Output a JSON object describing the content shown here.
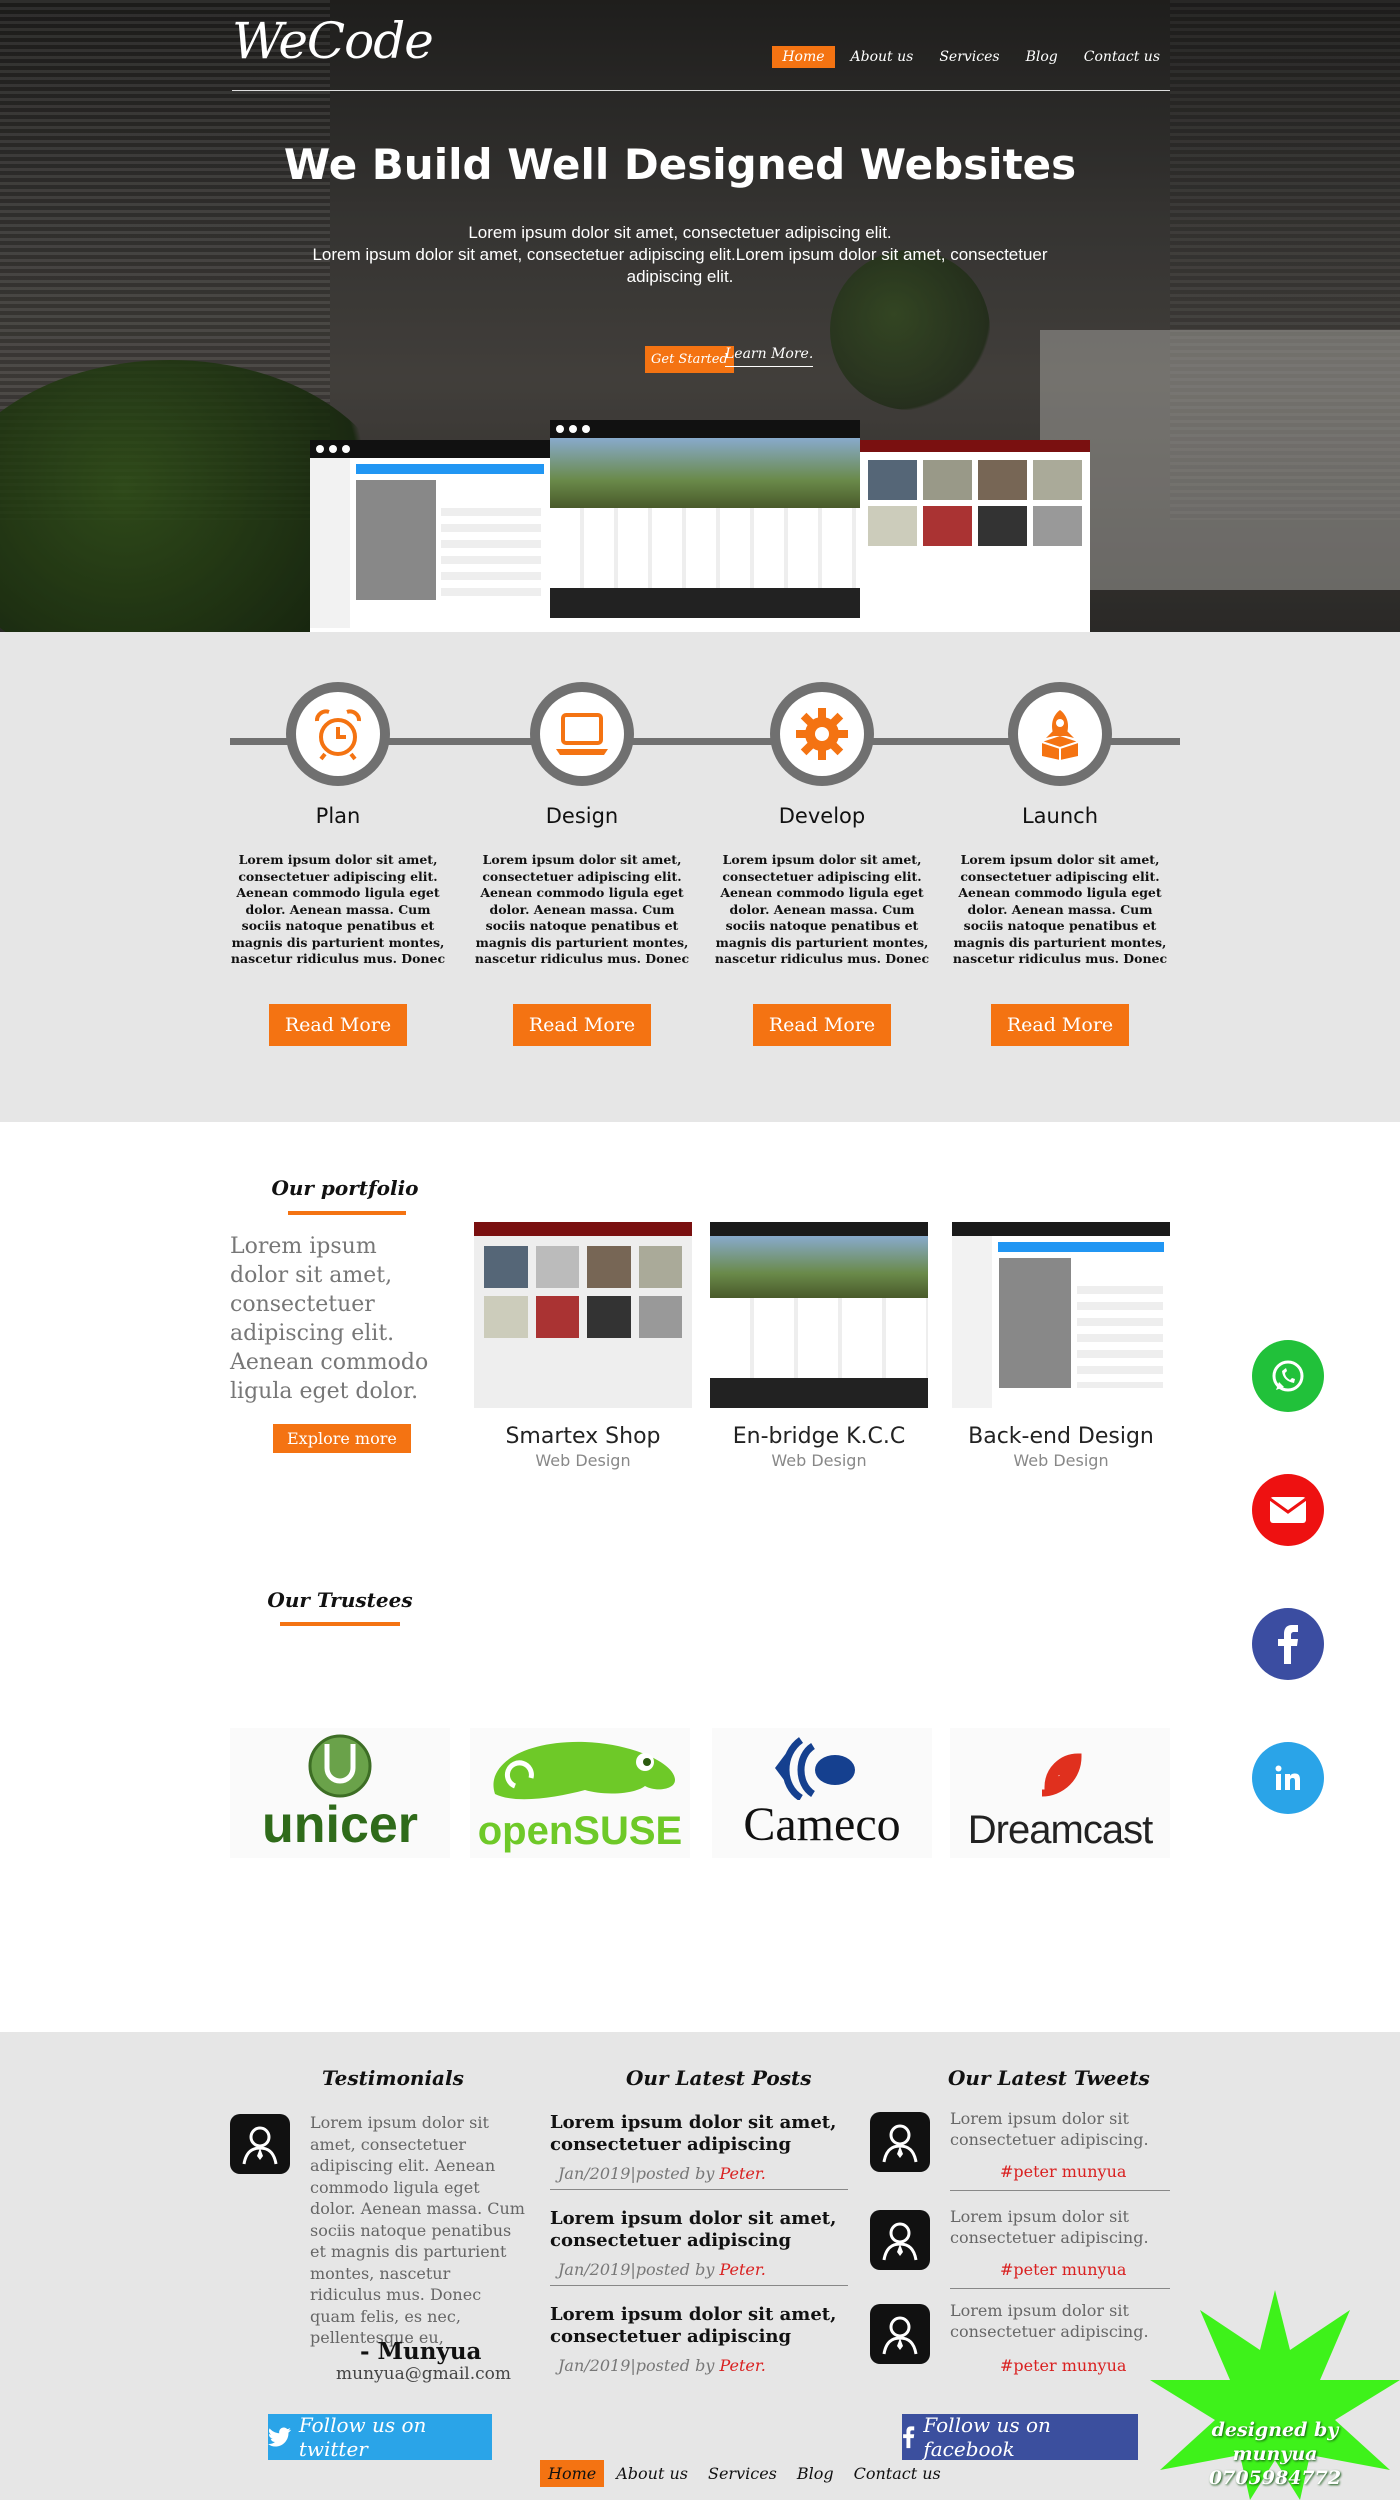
{
  "brand": {
    "logo": "WeCode",
    "accent": "#f47312"
  },
  "nav": {
    "items": [
      "Home",
      "About us",
      "Services",
      "Blog",
      "Contact us"
    ],
    "active": "Home"
  },
  "hero": {
    "title": "We Build Well Designed Websites",
    "line1": "Lorem ipsum dolor sit amet, consectetuer adipiscing elit.",
    "line2": "Lorem ipsum dolor sit amet, consectetuer adipiscing elit.Lorem ipsum dolor sit amet, consectetuer adipiscing elit.",
    "cta_primary": "Get Started",
    "cta_secondary": "Learn More."
  },
  "process": {
    "steps": [
      {
        "title": "Plan",
        "icon": "alarm-clock-icon",
        "text": "Lorem ipsum dolor sit amet, consectetuer adipiscing elit. Aenean commodo ligula eget dolor. Aenean massa. Cum sociis natoque penatibus et magnis dis parturient montes, nascetur ridiculus mus. Donec quam felis, ultricies nec,",
        "button": "Read More"
      },
      {
        "title": "Design",
        "icon": "laptop-icon",
        "text": "Lorem ipsum dolor sit amet, consectetuer adipiscing elit. Aenean commodo ligula eget dolor. Aenean massa. Cum sociis natoque penatibus et magnis dis parturient montes, nascetur ridiculus mus. Donec quam felis, ultricies nec,",
        "button": "Read More"
      },
      {
        "title": "Develop",
        "icon": "gear-icon",
        "text": "Lorem ipsum dolor sit amet, consectetuer adipiscing elit. Aenean commodo ligula eget dolor. Aenean massa. Cum sociis natoque penatibus et magnis dis parturient montes, nascetur ridiculus mus. Donec quam felis, ultricies nec,",
        "button": "Read More"
      },
      {
        "title": "Launch",
        "icon": "rocket-icon",
        "text": "Lorem ipsum dolor sit amet, consectetuer adipiscing elit. Aenean commodo ligula eget dolor. Aenean massa. Cum sociis natoque penatibus et magnis dis parturient montes, nascetur ridiculus mus. Donec quam felis, ultricies nec,",
        "button": "Read More"
      }
    ]
  },
  "portfolio": {
    "title": "Our portfolio",
    "lead": "Lorem ipsum dolor sit amet, consectetuer adipiscing elit. Aenean commodo ligula eget dolor.",
    "button": "Explore more",
    "items": [
      {
        "name": "Smartex Shop",
        "category": "Web Design"
      },
      {
        "name": "En-bridge K.C.C",
        "category": "Web Design"
      },
      {
        "name": "Back-end Design",
        "category": "Web Design"
      }
    ]
  },
  "social": [
    {
      "name": "whatsapp-icon",
      "color": "#21c13a"
    },
    {
      "name": "mail-icon",
      "color": "#ee1111"
    },
    {
      "name": "facebook-icon",
      "color": "#3b4da1"
    },
    {
      "name": "linkedin-icon",
      "color": "#2aa4e8"
    }
  ],
  "trustees": {
    "title": "Our Trustees",
    "logos": [
      "unicer",
      "openSUSE",
      "Cameco",
      "Dreamcast"
    ]
  },
  "footer": {
    "testimonials": {
      "title": "Testimonials",
      "text": "Lorem ipsum dolor sit amet, consectetuer adipiscing elit. Aenean commodo ligula eget dolor. Aenean massa. Cum sociis natoque penatibus et magnis dis parturient montes, nascetur ridiculus mus. Donec quam felis, es nec, pellentesque eu,",
      "name": "- Munyua",
      "email": "munyua@gmail.com"
    },
    "posts": {
      "title": "Our Latest Posts",
      "items": [
        {
          "title": "Lorem ipsum dolor sit amet, consectetuer adipiscing",
          "date": "Jan/2019|posted by ",
          "author": "Peter."
        },
        {
          "title": "Lorem ipsum dolor sit amet, consectetuer adipiscing",
          "date": "Jan/2019|posted by ",
          "author": "Peter."
        },
        {
          "title": "Lorem ipsum dolor sit amet, consectetuer adipiscing",
          "date": "Jan/2019|posted by ",
          "author": "Peter."
        }
      ]
    },
    "tweets": {
      "title": "Our Latest Tweets",
      "items": [
        {
          "text": "Lorem ipsum dolor sit consectetuer adipiscing.",
          "tag": "#peter munyua"
        },
        {
          "text": "Lorem ipsum dolor sit consectetuer adipiscing.",
          "tag": "#peter munyua"
        },
        {
          "text": "Lorem ipsum dolor sit consectetuer adipiscing.",
          "tag": "#peter munyua"
        }
      ]
    },
    "follow_twitter": "Follow us on twitter",
    "follow_facebook": "Follow us on facebook",
    "nav": [
      "Home",
      "About us",
      "Services",
      "Blog",
      "Contact us"
    ],
    "designer": "designed by munyua",
    "phone": "0705984772"
  }
}
